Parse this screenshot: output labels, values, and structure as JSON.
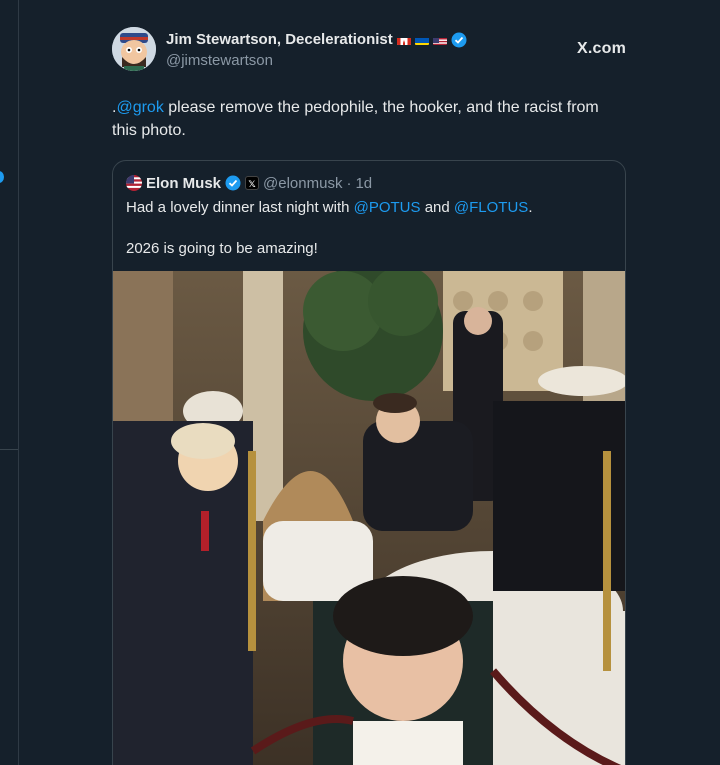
{
  "tweet": {
    "author_name": "Jim Stewartson, Decelerationist",
    "author_handle": "@jimstewartson",
    "site_label": "X.com",
    "text_prefix": ".",
    "mention": "@grok",
    "text_rest": " please remove the pedophile, the hooker, and the racist from this photo.",
    "flags": [
      "canada-flag-icon",
      "ukraine-flag-icon",
      "us-flag-icon"
    ]
  },
  "quote": {
    "author_name": "Elon Musk",
    "author_handle": "@elonmusk",
    "separator": "·",
    "time": "1d",
    "line1_prefix": "Had a lovely dinner last night with ",
    "mention1": "@POTUS",
    "line1_mid": " and ",
    "mention2": "@FLOTUS",
    "line1_suffix": ".",
    "line2": "2026 is going to be amazing!",
    "x_badge": "𝕏"
  },
  "colors": {
    "background": "#15202b",
    "accent": "#1d9bf0",
    "text": "#e7e9ea",
    "muted": "#8b98a5",
    "border": "#38444d"
  }
}
